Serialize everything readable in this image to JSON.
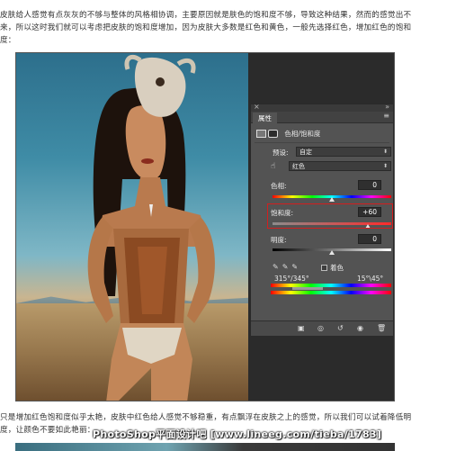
{
  "article": {
    "paragraph_top": "皮肤给人感觉有点灰灰的不够与整体的风格相协调，主要原因就是肤色的饱和度不够，导致这种结果，然而的感觉出不来，所以这时我们就可以考虑把皮肤的饱和度增加，因为皮肤大多数是红色和黄色，一般先选择红色，增加红色的饱和度：",
    "paragraph_bottom": "只是增加红色饱和度似乎太艳，皮肤中红色给人感觉不够稳重，有点飘浮在皮肤之上的感觉，所以我们可以试着降低明度，让颜色不要如此艳丽："
  },
  "watermark": "PhotoShop平面设计吧 [www.lineeg.com/tieba/1783]",
  "panel": {
    "tab_label": "属性",
    "adjustment_title": "色相/饱和度",
    "preset_label": "预设:",
    "preset_value": "自定",
    "channel_value": "红色",
    "hue_label": "色相:",
    "hue_value": "0",
    "hue_level": 0.5,
    "saturation_label": "饱和度:",
    "saturation_value": "+60",
    "saturation_level": 0.8,
    "lightness_label": "明度:",
    "lightness_value": "0",
    "lightness_level": 0.5,
    "colorize_label": "着色",
    "range_left": "315°/345°",
    "range_right": "15°\\45°"
  },
  "colors": {
    "highlight": "#d21f1f",
    "panel_bg": "#535353",
    "workspace_bg": "#2b2b2b"
  },
  "icons": [
    "close-icon",
    "panel-menu-icon",
    "adjustment-layer-icon",
    "mask-icon",
    "hand-target-icon",
    "eyedropper-icon",
    "eyedropper-plus-icon",
    "eyedropper-minus-icon",
    "clip-to-layer-icon",
    "view-previous-icon",
    "reset-icon",
    "visibility-eye-icon",
    "trash-icon"
  ]
}
